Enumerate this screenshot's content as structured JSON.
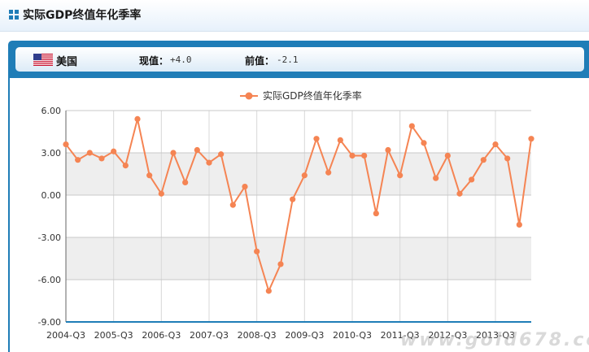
{
  "header": {
    "title": "实际GDP终值年化季率"
  },
  "info": {
    "country": "美国",
    "current_label": "现值：",
    "current_value": "+4.0",
    "previous_label": "前值：",
    "previous_value": "-2.1"
  },
  "watermark": "www.gold678.com",
  "chart_data": {
    "type": "line",
    "legend": "实际GDP终值年化季率",
    "legend_position": "top-center",
    "grid": true,
    "ylim": [
      -9,
      6
    ],
    "yticks": [
      6,
      3,
      0,
      -3,
      -6,
      -9
    ],
    "ytick_labels": [
      "6.00",
      "3.00",
      "0.00",
      "-3.00",
      "-6.00",
      "-9.00"
    ],
    "xtick_labels": [
      "2004-Q3",
      "2005-Q3",
      "2006-Q3",
      "2007-Q3",
      "2008-Q3",
      "2009-Q3",
      "2010-Q3",
      "2011-Q3",
      "2012-Q3",
      "2013-Q3"
    ],
    "xtick_start_index": 0,
    "xtick_step": 4,
    "line_color": "#f58453",
    "series": [
      {
        "name": "实际GDP终值年化季率",
        "values": [
          3.6,
          2.5,
          3.0,
          2.6,
          3.1,
          2.1,
          5.4,
          1.4,
          0.1,
          3.0,
          0.9,
          3.2,
          2.3,
          2.9,
          -0.7,
          0.6,
          -4.0,
          -6.8,
          -4.9,
          -0.3,
          1.4,
          4.0,
          1.6,
          3.9,
          2.8,
          2.8,
          -1.3,
          3.2,
          1.4,
          4.9,
          3.7,
          1.2,
          2.8,
          0.1,
          1.1,
          2.5,
          3.6,
          2.6,
          -2.1,
          4.0
        ]
      }
    ]
  }
}
